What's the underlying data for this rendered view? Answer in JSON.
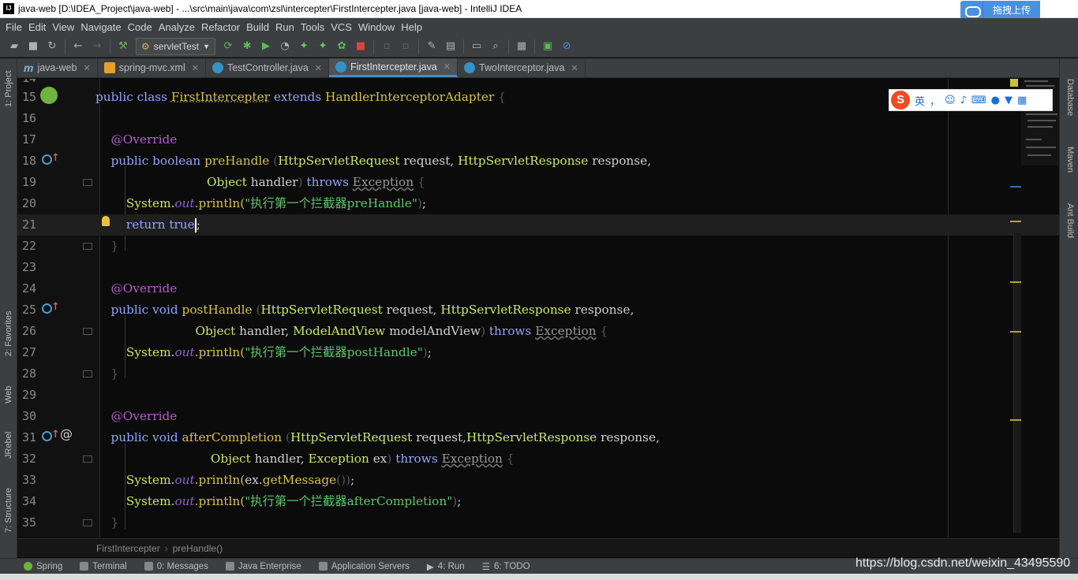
{
  "window": {
    "title": "java-web [D:\\IDEA_Project\\java-web] - ...\\src\\main\\java\\com\\zsl\\intercepter\\FirstIntercepter.java [java-web] - IntelliJ IDEA",
    "upload_button": "拖拽上传"
  },
  "menu": [
    "File",
    "Edit",
    "View",
    "Navigate",
    "Code",
    "Analyze",
    "Refactor",
    "Build",
    "Run",
    "Tools",
    "VCS",
    "Window",
    "Help"
  ],
  "toolbar": {
    "run_config": "servletTest"
  },
  "tabs": [
    {
      "label": "java-web",
      "icon": "module-m-icon",
      "active": false
    },
    {
      "label": "spring-mvc.xml",
      "icon": "xml-file-icon",
      "active": false
    },
    {
      "label": "TestController.java",
      "icon": "java-class-icon",
      "active": false
    },
    {
      "label": "FirstIntercepter.java",
      "icon": "java-class-icon",
      "active": true
    },
    {
      "label": "TwoInterceptor.java",
      "icon": "java-class-icon",
      "active": false
    }
  ],
  "left_tool_windows": [
    "1: Project",
    "2: Favorites",
    "Web",
    "JRebel",
    "7: Structure"
  ],
  "right_tool_windows": [
    "Database",
    "Maven",
    "Ant Build"
  ],
  "ime": {
    "mode": "英",
    "punct": "，"
  },
  "code": {
    "line_numbers": [
      "14",
      "15",
      "16",
      "17",
      "18",
      "19",
      "20",
      "21",
      "22",
      "23",
      "24",
      "25",
      "26",
      "27",
      "28",
      "29",
      "30",
      "31",
      "32",
      "33",
      "34",
      "35"
    ],
    "class_decl": {
      "kw1": "public",
      "kw2": "class",
      "name": "FirstIntercepter",
      "kw3": "extends",
      "parent": "HandlerInterceptorAdapter",
      "brace": "{"
    },
    "annotation": "@Override",
    "pre": {
      "kw1": "public",
      "ret": "boolean",
      "name": "preHandle",
      "p1type": "HttpServletRequest",
      "p1": "request,",
      "p2type": "HttpServletResponse",
      "p2": "response,",
      "p3type": "Object",
      "p3": "handler",
      "throws": "throws",
      "exc": "Exception"
    },
    "pre_println": "\"执行第一个拦截器preHandle\"",
    "return_kw": "return",
    "return_val": "true",
    "post": {
      "kw1": "public",
      "ret": "void",
      "name": "postHandle",
      "p1type": "HttpServletRequest",
      "p1": "request,",
      "p2type": "HttpServletResponse",
      "p2": "response,",
      "p3type": "Object",
      "p3": "handler,",
      "p4type": "ModelAndView",
      "p4": "modelAndView",
      "throws": "throws",
      "exc": "Exception"
    },
    "post_println": "\"执行第一个拦截器postHandle\"",
    "after": {
      "kw1": "public",
      "ret": "void",
      "name": "afterCompletion",
      "p1type": "HttpServletRequest",
      "p1": "request,",
      "p2type": "HttpServletResponse",
      "p2": "response,",
      "p3type": "Object",
      "p3": "handler,",
      "p4type": "Exception",
      "p4": "ex",
      "throws": "throws",
      "exc": "Exception"
    },
    "sys": "System.",
    "out": "out",
    "println": ".println(",
    "ex_get": "ex.",
    "get_message": "getMessage",
    "after_println": "\"执行第一个拦截器afterCompletion\""
  },
  "breadcrumb": [
    "FirstIntercepter",
    "preHandle()"
  ],
  "bottom_tools": [
    "Spring",
    "Terminal",
    "0: Messages",
    "Java Enterprise",
    "Application Servers",
    "4: Run",
    "6: TODO"
  ],
  "watermark": "https://blog.csdn.net/weixin_43495590"
}
